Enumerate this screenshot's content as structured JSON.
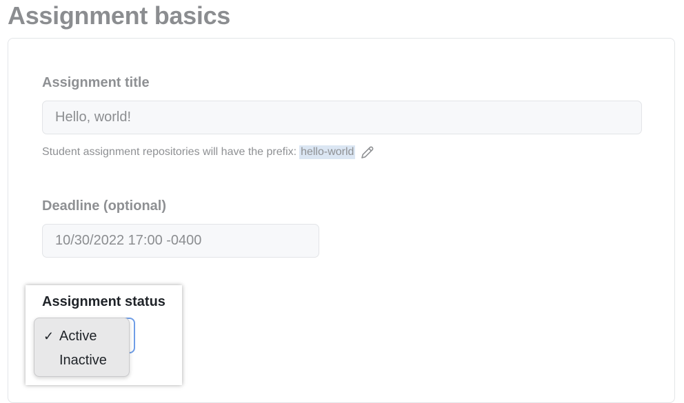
{
  "page": {
    "title": "Assignment basics"
  },
  "assignment_title": {
    "label": "Assignment title",
    "value": "Hello, world!",
    "hint_text": "Student assignment repositories will have the prefix:",
    "prefix": "hello-world"
  },
  "deadline": {
    "label": "Deadline (optional)",
    "value": "10/30/2022 17:00 -0400"
  },
  "assignment_status": {
    "label": "Assignment status",
    "options": [
      {
        "label": "Active",
        "selected": true,
        "check": "✓"
      },
      {
        "label": "Inactive",
        "selected": false,
        "check": ""
      }
    ]
  },
  "icons": {
    "edit": "pencil-icon"
  },
  "colors": {
    "highlight": "#dbe6f3",
    "focus_ring": "#6e9de6"
  }
}
